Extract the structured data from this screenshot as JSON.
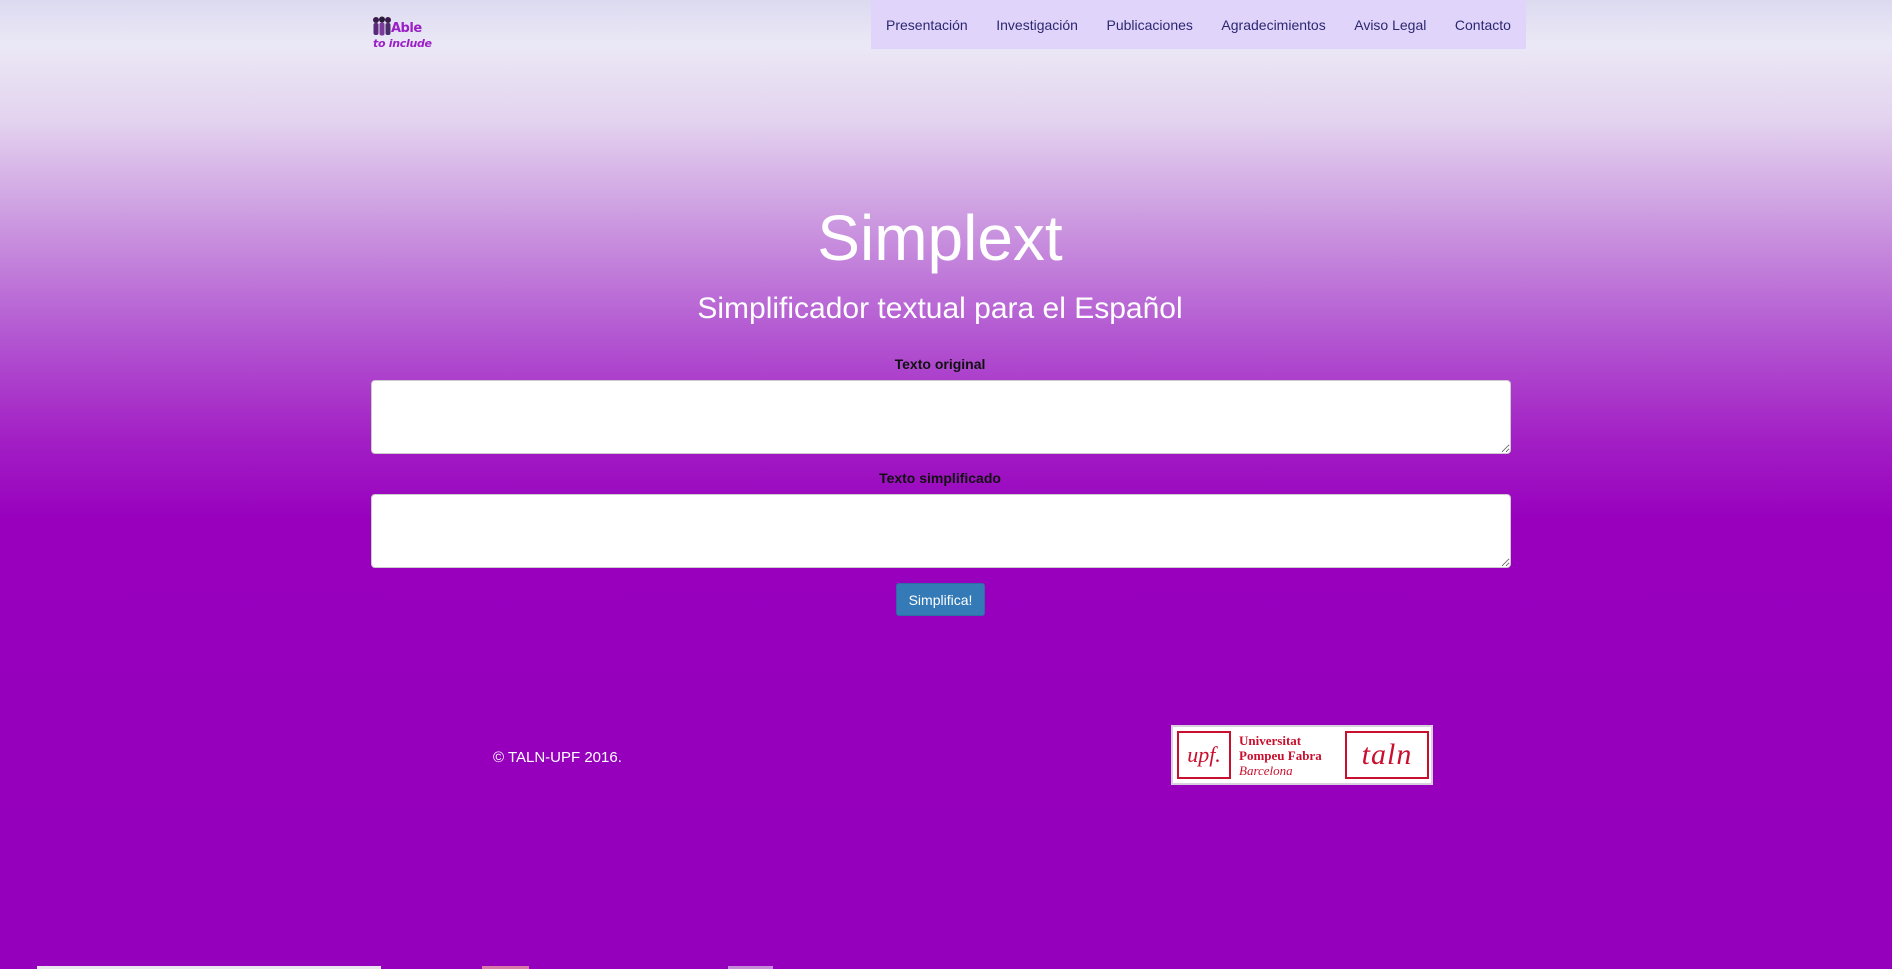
{
  "brand": {
    "logo_line1": "Able",
    "logo_line2": "to include",
    "logo_color": "#9a1fc7"
  },
  "nav": {
    "items": [
      "Presentación",
      "Investigación",
      "Publicaciones",
      "Agradecimientos",
      "Aviso Legal",
      "Contacto"
    ]
  },
  "hero": {
    "title": "Simplext",
    "subtitle": "Simplificador textual para el Español"
  },
  "form": {
    "original_label": "Texto original",
    "original_value": "",
    "simplified_label": "Texto simplificado",
    "simplified_value": "",
    "submit_label": "Simplifica!"
  },
  "footer": {
    "copyright": "© TALN-UPF  2016.",
    "partner_logo": {
      "upf_mark": "upf.",
      "university_line1": "Universitat",
      "university_line2": "Pompeu Fabra",
      "university_line3": "Barcelona",
      "taln_mark": "taln"
    }
  },
  "colors": {
    "nav_background": "#e1d4fb",
    "nav_text": "#2b2870",
    "primary_button": "#337ab7",
    "page_purple": "#9400bb",
    "upf_red": "#c8102e"
  }
}
